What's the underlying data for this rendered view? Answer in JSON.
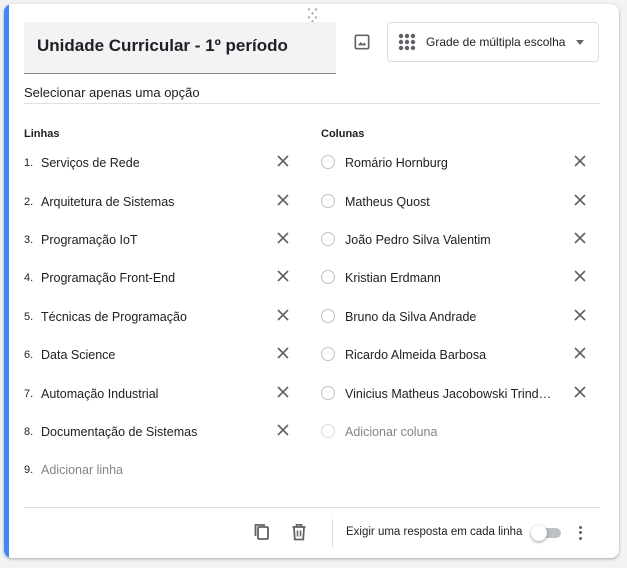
{
  "question": {
    "title": "Unidade Curricular - 1º período",
    "type_label": "Grade de múltipla escolha",
    "subtitle": "Selecionar apenas uma opção"
  },
  "rows": {
    "header": "Linhas",
    "items": [
      {
        "num": "1.",
        "label": "Serviços de Rede"
      },
      {
        "num": "2.",
        "label": "Arquitetura de Sistemas"
      },
      {
        "num": "3.",
        "label": "Programação IoT"
      },
      {
        "num": "4.",
        "label": "Programação Front-End"
      },
      {
        "num": "5.",
        "label": "Técnicas de Programação"
      },
      {
        "num": "6.",
        "label": "Data Science"
      },
      {
        "num": "7.",
        "label": "Automação Industrial"
      },
      {
        "num": "8.",
        "label": "Documentação de Sistemas"
      }
    ],
    "add_num": "9.",
    "add_label": "Adicionar linha"
  },
  "columns": {
    "header": "Colunas",
    "items": [
      {
        "label": "Romário Hornburg"
      },
      {
        "label": "Matheus Quost"
      },
      {
        "label": "João Pedro Silva Valentim"
      },
      {
        "label": "Kristian Erdmann"
      },
      {
        "label": "Bruno da Silva Andrade"
      },
      {
        "label": "Ricardo Almeida Barbosa"
      },
      {
        "label": "Vinicius Matheus Jacobowski Trind…"
      }
    ],
    "add_label": "Adicionar coluna"
  },
  "footer": {
    "require_label": "Exigir uma resposta em cada linha",
    "require_enabled": false
  },
  "icons": {
    "image": "image-icon",
    "grid": "grid-icon",
    "remove": "close-icon",
    "duplicate": "copy-icon",
    "delete": "trash-icon",
    "more": "more-vert-icon"
  },
  "colors": {
    "accent": "#4285f4",
    "text": "#202124",
    "muted": "#80868b"
  }
}
